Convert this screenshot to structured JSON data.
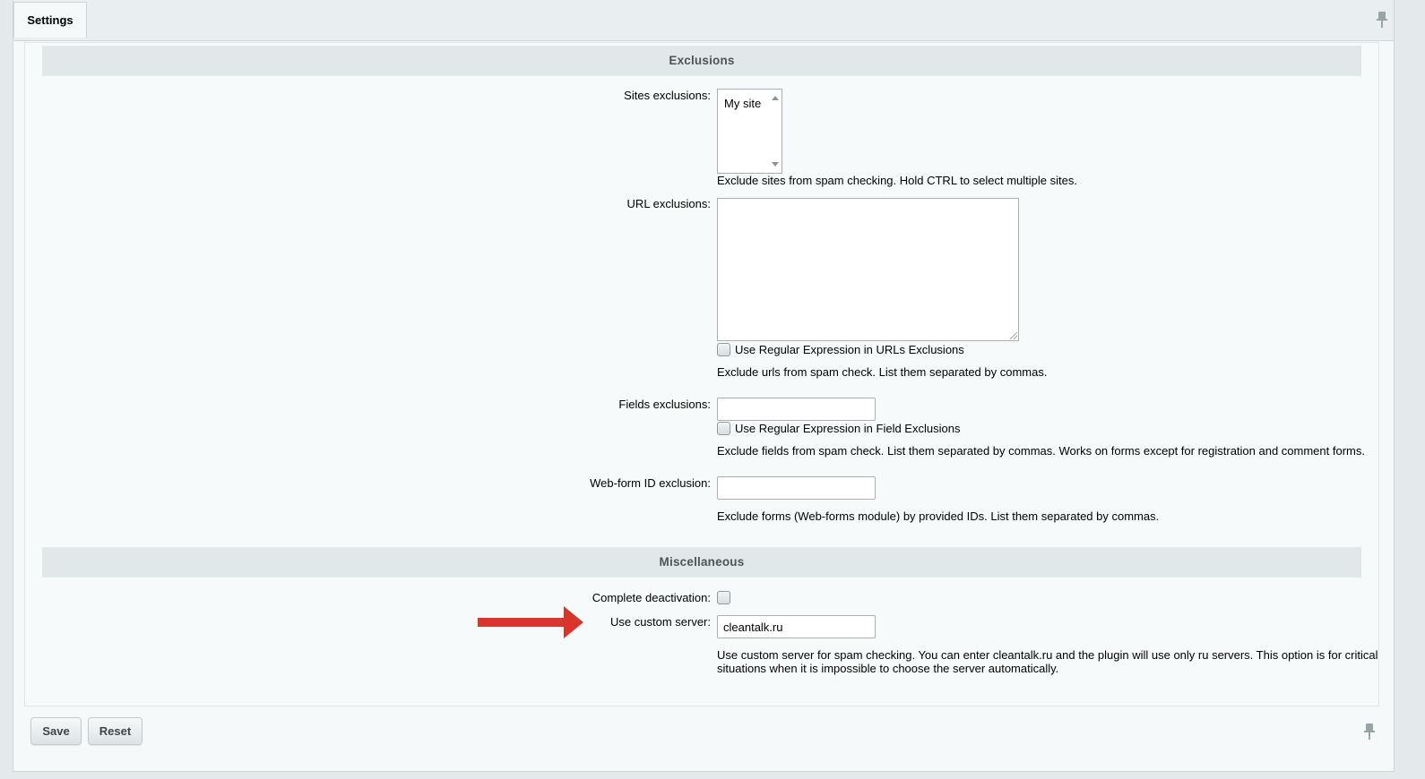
{
  "tab": {
    "label": "Settings"
  },
  "sections": {
    "exclusions": "Exclusions",
    "misc": "Miscellaneous"
  },
  "sites": {
    "label": "Sites exclusions:",
    "option": "My site",
    "hint": "Exclude sites from spam checking. Hold CTRL to select multiple sites."
  },
  "urls": {
    "label": "URL exclusions:",
    "value": "",
    "regex_label": "Use Regular Expression in URLs Exclusions",
    "hint": "Exclude urls from spam check. List them separated by commas."
  },
  "fields": {
    "label": "Fields exclusions:",
    "value": "",
    "regex_label": "Use Regular Expression in Field Exclusions",
    "hint": "Exclude fields from spam check. List them separated by commas. Works on forms except for registration and comment forms."
  },
  "webform": {
    "label": "Web-form ID exclusion:",
    "value": "",
    "hint": "Exclude forms (Web-forms module) by provided IDs. List them separated by commas."
  },
  "deactivation": {
    "label": "Complete deactivation:"
  },
  "custom_server": {
    "label": "Use custom server:",
    "value": "cleantalk.ru",
    "hint_line1": "Use custom server for spam checking. You can enter cleantalk.ru and the plugin will use only ru servers. This option is for critical",
    "hint_line2": "situations when it is impossible to choose the server automatically."
  },
  "buttons": {
    "save": "Save",
    "reset": "Reset"
  },
  "colors": {
    "arrow": "#d9362b",
    "section_bg": "#e1e8ea"
  },
  "icons": {
    "pin": "pin-icon"
  }
}
